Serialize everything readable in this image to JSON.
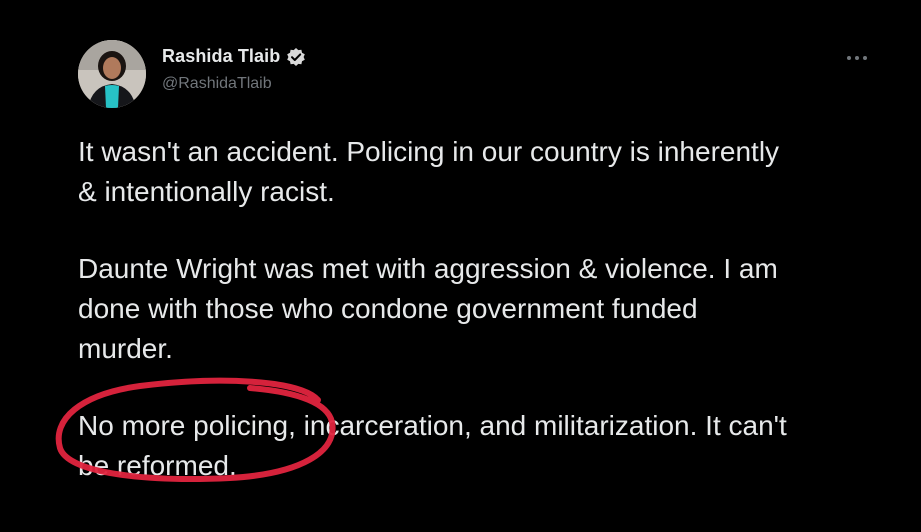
{
  "tweet": {
    "author": {
      "display_name": "Rashida Tlaib",
      "handle": "@RashidaTlaib",
      "verified": true
    },
    "more_icon": "ellipsis-icon",
    "paragraphs": [
      {
        "lines": [
          "It wasn't an accident. Policing in our country is inherently",
          "& intentionally racist."
        ]
      },
      {
        "lines": [
          "Daunte Wright was met with aggression & violence. I am",
          "done with those who condone government funded",
          "murder."
        ]
      },
      {
        "lines": [
          "No more policing, incarceration, and militarization. It can't",
          "be reformed."
        ]
      }
    ],
    "annotation": {
      "shape": "circle",
      "color": "#e0243e",
      "circled_text": "No more policing,"
    }
  },
  "colors": {
    "background": "#000000",
    "text_primary": "#e7e9ea",
    "text_secondary": "#71767b",
    "verified_badge": "#d9d9d9",
    "annotation": "#e0243e"
  }
}
